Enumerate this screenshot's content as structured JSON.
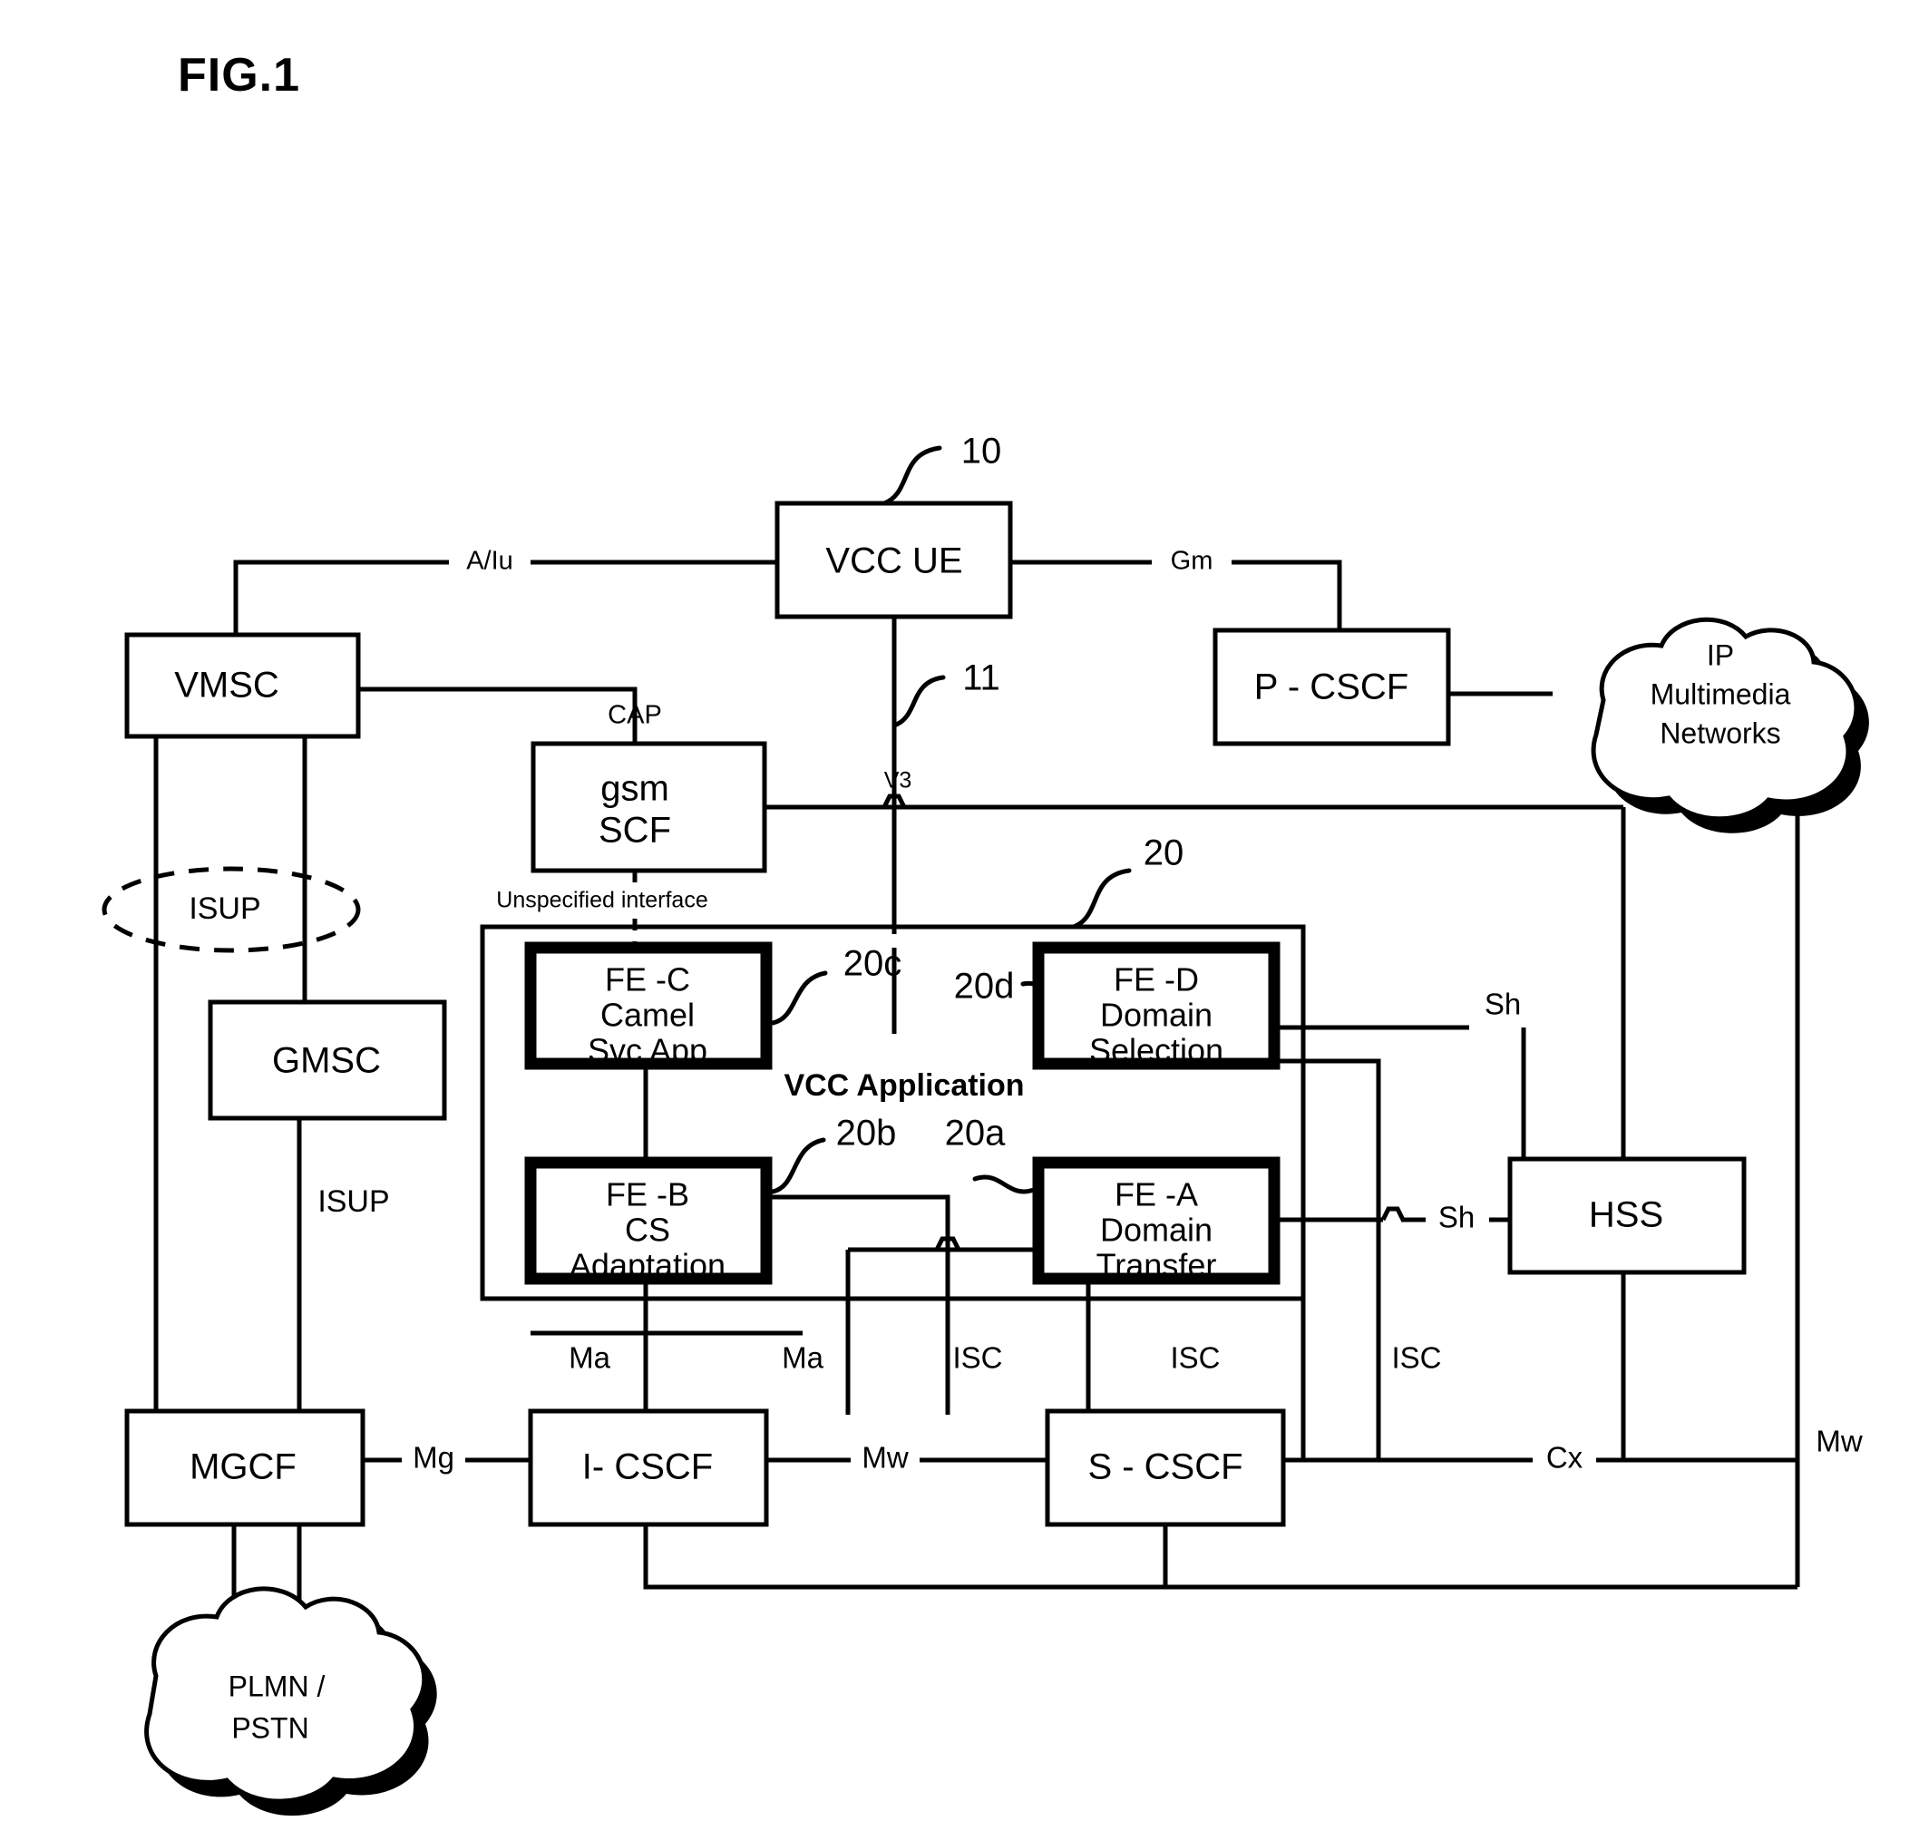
{
  "figure": {
    "title": "FIG.1"
  },
  "nodes": {
    "vcc_ue": {
      "label": "VCC UE",
      "ref": "10"
    },
    "vmsc": {
      "label": "VMSC"
    },
    "gmsc": {
      "label": "GMSC"
    },
    "mgcf": {
      "label": "MGCF"
    },
    "gsm_scf": {
      "line1": "gsm",
      "line2": "SCF"
    },
    "p_cscf": {
      "label": "P - CSCF"
    },
    "i_cscf": {
      "label": "I- CSCF"
    },
    "s_cscf": {
      "label": "S - CSCF"
    },
    "hss": {
      "label": "HSS"
    },
    "fe_c": {
      "line1": "FE -C",
      "line2": "Camel",
      "line3": "Svc App",
      "ref": "20c"
    },
    "fe_d": {
      "line1": "FE -D",
      "line2": "Domain",
      "line3": "Selection",
      "ref": "20d"
    },
    "fe_b": {
      "line1": "FE -B",
      "line2": "CS",
      "line3": "Adaptation",
      "ref": "20b"
    },
    "fe_a": {
      "line1": "FE -A",
      "line2": "Domain",
      "line3": "Transfer",
      "ref": "20a"
    },
    "vcc_application": {
      "label": "VCC Application",
      "ref": "20"
    }
  },
  "clouds": {
    "ip_multimedia": {
      "line1": "IP",
      "line2": "Multimedia",
      "line3": "Networks"
    },
    "plmn_pstn": {
      "line1": "PLMN  /",
      "line2": "PSTN"
    }
  },
  "interfaces": {
    "a_iu": "A/Iu",
    "gm": "Gm",
    "cap": "CAP",
    "v3": "V3",
    "v3_ref": "11",
    "unspecified": "Unspecified interface",
    "isup_ellipse": "ISUP",
    "isup_vertical": "ISUP",
    "ma_left": "Ma",
    "ma_right": "Ma",
    "isc_1": "ISC",
    "isc_2": "ISC",
    "isc_3": "ISC",
    "sh_top": "Sh",
    "sh_bottom": "Sh",
    "mg": "Mg",
    "mw_mid": "Mw",
    "cx": "Cx",
    "mw_right": "Mw"
  },
  "colors": {
    "line": "#000000",
    "background": "#ffffff"
  }
}
